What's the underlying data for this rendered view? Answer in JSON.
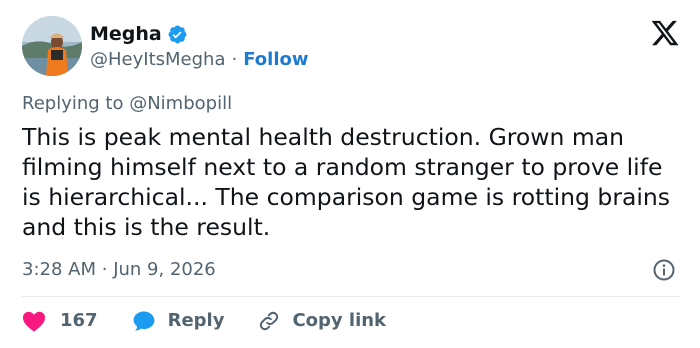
{
  "author": {
    "display_name": "Megha",
    "handle": "@HeyItsMegha",
    "separator": "·",
    "follow_label": "Follow",
    "verified": true
  },
  "reply_context": {
    "prefix": "Replying to",
    "handle": "@Nimbopill"
  },
  "tweet": {
    "text": "This is peak mental health destruction. Grown man filming himself next to a random stranger to prove life is hierarchical... The comparison game is rotting brains and this is the result.",
    "time": "3:28 AM",
    "separator": "·",
    "date": "Jun 9, 2026"
  },
  "actions": {
    "like_count": "167",
    "reply_label": "Reply",
    "copy_label": "Copy link"
  },
  "icons": {
    "brand": "x-logo-icon",
    "verified": "verified-badge-icon",
    "info": "info-icon",
    "like": "heart-icon",
    "reply": "speech-bubble-icon",
    "copy": "link-icon"
  },
  "colors": {
    "text": "#0f1419",
    "secondary": "#536471",
    "accent": "#1d9bf0",
    "like": "#f91880",
    "divider": "#e6ecf0"
  }
}
